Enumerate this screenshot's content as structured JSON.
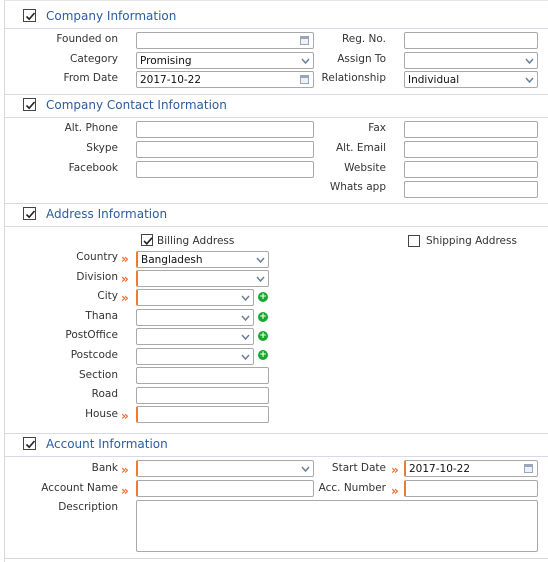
{
  "company": {
    "title": "Company Information",
    "founded_on_label": "Founded on",
    "founded_on_value": "",
    "reg_no_label": "Reg. No.",
    "reg_no_value": "",
    "category_label": "Category",
    "category_value": "Promising",
    "assign_to_label": "Assign To",
    "assign_to_value": "",
    "from_date_label": "From Date",
    "from_date_value": "2017-10-22",
    "relationship_label": "Relationship",
    "relationship_value": "Individual"
  },
  "contact": {
    "title": "Company Contact Information",
    "alt_phone_label": "Alt. Phone",
    "fax_label": "Fax",
    "skype_label": "Skype",
    "alt_email_label": "Alt. Email",
    "facebook_label": "Facebook",
    "website_label": "Website",
    "whatsapp_label": "Whats app"
  },
  "address": {
    "title": "Address Information",
    "billing_label": "Billing Address",
    "billing_checked": true,
    "shipping_label": "Shipping Address",
    "shipping_checked": false,
    "country_label": "Country",
    "country_value": "Bangladesh",
    "division_label": "Division",
    "city_label": "City",
    "thana_label": "Thana",
    "postoffice_label": "PostOffice",
    "postcode_label": "Postcode",
    "section_label": "Section",
    "road_label": "Road",
    "house_label": "House"
  },
  "account": {
    "title": "Account Information",
    "bank_label": "Bank",
    "start_date_label": "Start Date",
    "start_date_value": "2017-10-22",
    "account_name_label": "Account Name",
    "acc_number_label": "Acc. Number",
    "description_label": "Description"
  },
  "colors": {
    "section_title": "#2a5d9f",
    "required_marker": "#ee6a2a",
    "add_button": "#17a82c"
  },
  "icons": {
    "required": "double-chevron-right",
    "add": "plus-circle",
    "calendar": "calendar",
    "dropdown": "chevron-down",
    "check": "checkmark"
  }
}
